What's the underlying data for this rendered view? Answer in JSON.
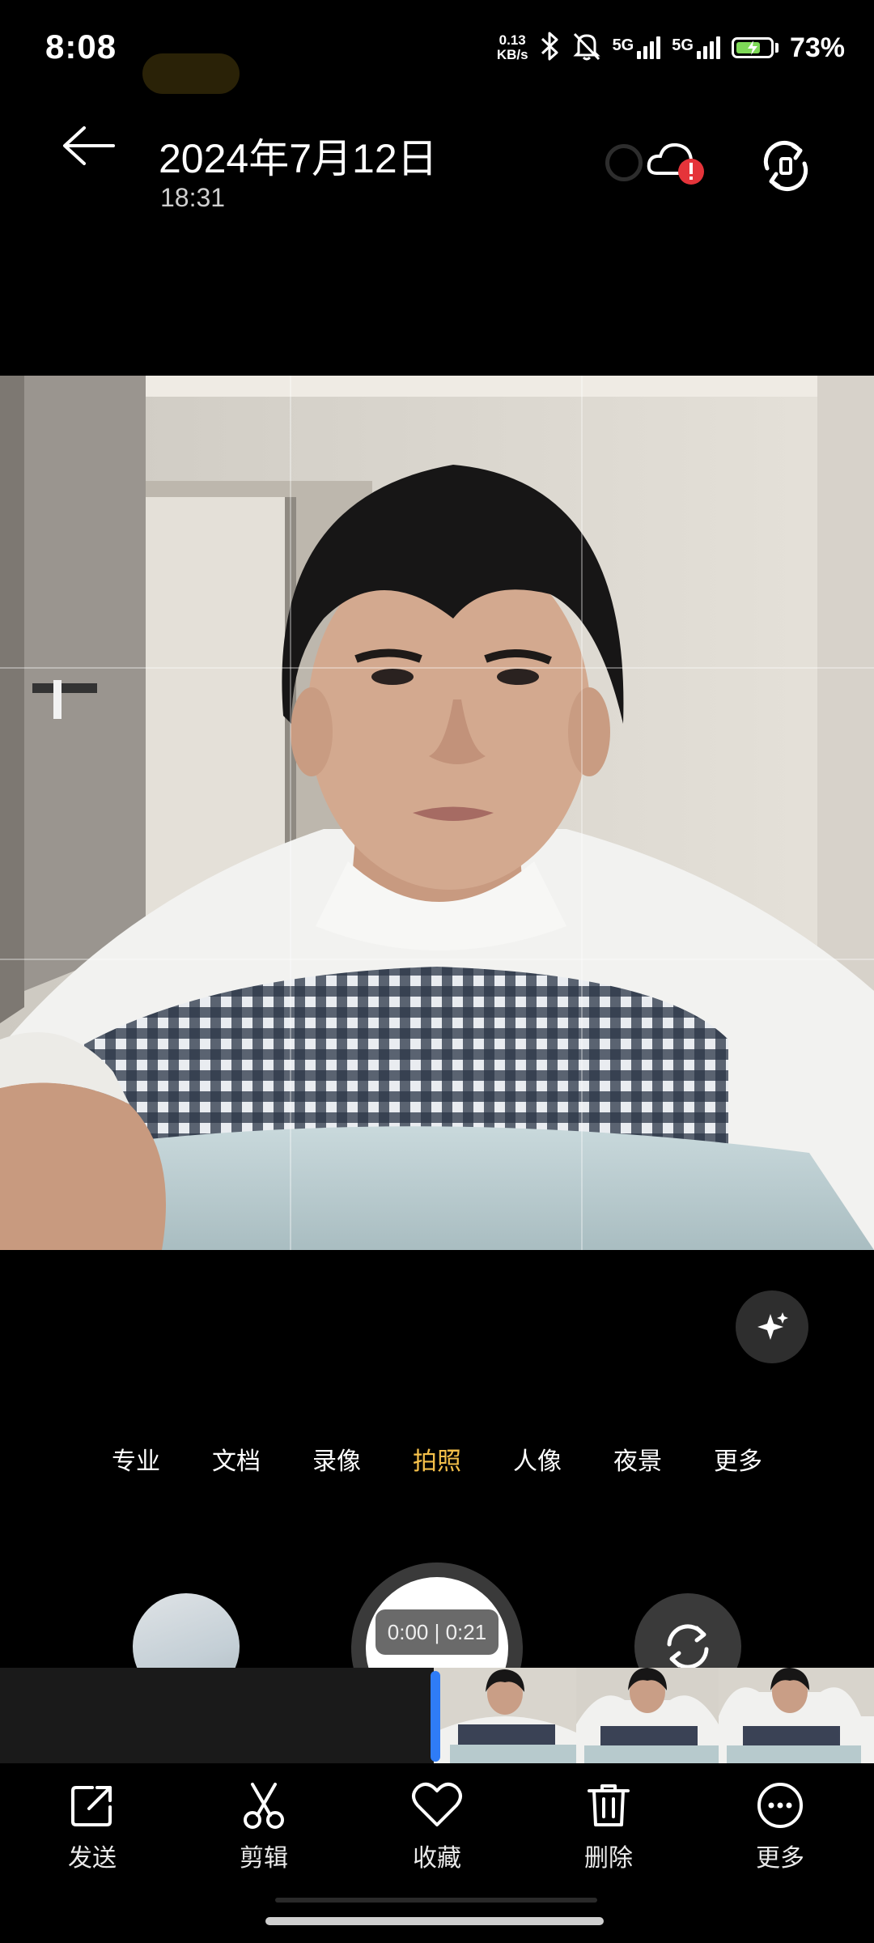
{
  "status_bar": {
    "time": "8:08",
    "net_speed_value": "0.13",
    "net_speed_unit": "KB/s",
    "sim1_label": "5G",
    "sim2_label": "5G",
    "battery_percent": "73%",
    "battery_level": 0.73,
    "icons": [
      "bluetooth-icon",
      "mute-bell-icon",
      "signal-icon",
      "battery-charging-icon"
    ]
  },
  "header": {
    "title": "2024年7月12日",
    "subtitle": "18:31"
  },
  "camera_modes": [
    {
      "label": "专业",
      "active": false
    },
    {
      "label": "文档",
      "active": false
    },
    {
      "label": "录像",
      "active": false
    },
    {
      "label": "拍照",
      "active": true
    },
    {
      "label": "人像",
      "active": false
    },
    {
      "label": "夜景",
      "active": false
    },
    {
      "label": "更多",
      "active": false
    }
  ],
  "video": {
    "timecode": "0:00 | 0:21",
    "progress": 0.0
  },
  "actions": [
    {
      "label": "发送",
      "icon": "share-icon"
    },
    {
      "label": "剪辑",
      "icon": "scissors-icon"
    },
    {
      "label": "收藏",
      "icon": "heart-icon"
    },
    {
      "label": "删除",
      "icon": "trash-icon"
    },
    {
      "label": "更多",
      "icon": "more-dots-icon"
    }
  ],
  "colors": {
    "active_mode": "#f5c04a",
    "playhead": "#2f7cf6",
    "cloud_alert": "#e5343a"
  }
}
